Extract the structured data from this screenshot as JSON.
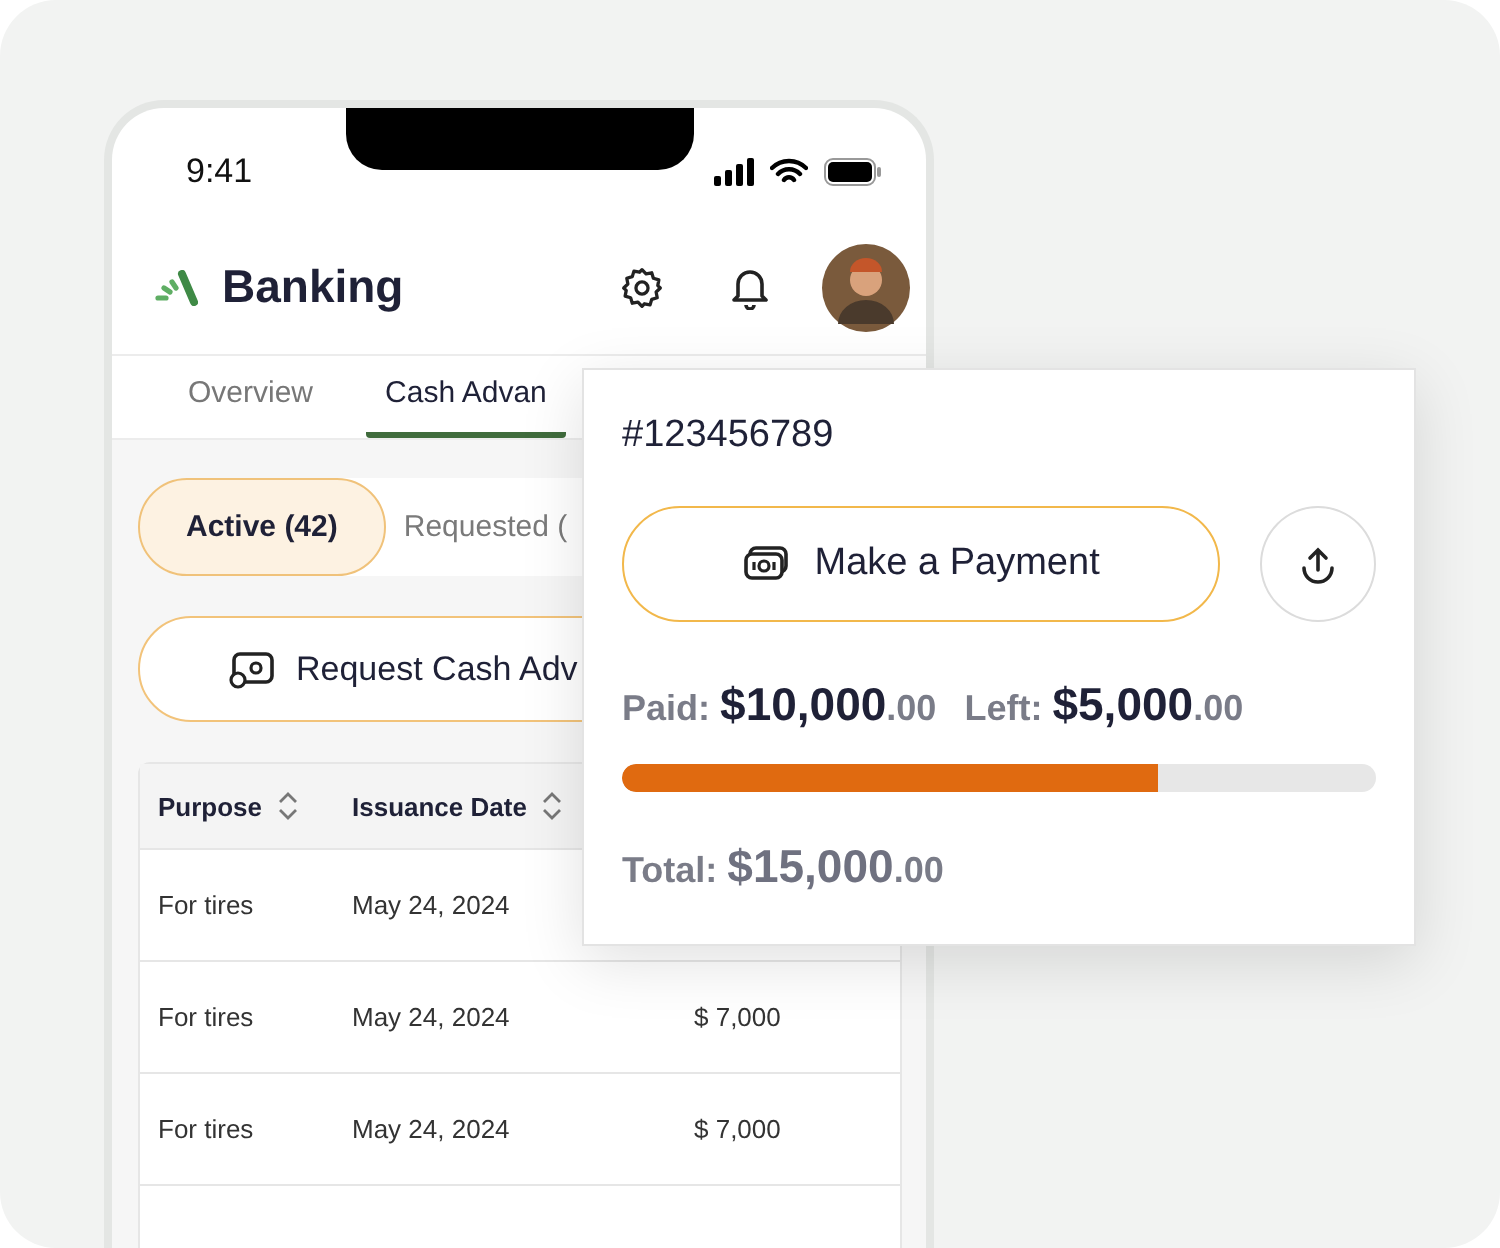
{
  "status_bar": {
    "time": "9:41"
  },
  "header": {
    "title": "Banking"
  },
  "tabs": [
    {
      "label": "Overview",
      "selected": false
    },
    {
      "label": "Cash Advan",
      "selected": true
    }
  ],
  "filters": [
    {
      "label": "Active (42)",
      "selected": true
    },
    {
      "label": "Requested (",
      "selected": false
    }
  ],
  "request_button": {
    "label": "Request Cash Adv"
  },
  "table": {
    "columns": [
      "Purpose",
      "Issuance Date"
    ],
    "rows": [
      {
        "purpose": "For tires",
        "date": "May 24, 2024"
      },
      {
        "purpose": "For tires",
        "date": "May 24, 2024",
        "amount": "$ 7,000"
      },
      {
        "purpose": "For tires",
        "date": "May 24, 2024",
        "amount": "$ 7,000"
      }
    ]
  },
  "popup": {
    "id": "#123456789",
    "pay_button": "Make a Payment",
    "paid": {
      "label": "Paid:",
      "amount": "$10,000",
      "cents": ".00"
    },
    "left": {
      "label": "Left:",
      "amount": "$5,000",
      "cents": ".00"
    },
    "progress": {
      "level": 0.71
    },
    "total": {
      "label": "Total:",
      "amount": "$15,000",
      "cents": ".00"
    }
  }
}
